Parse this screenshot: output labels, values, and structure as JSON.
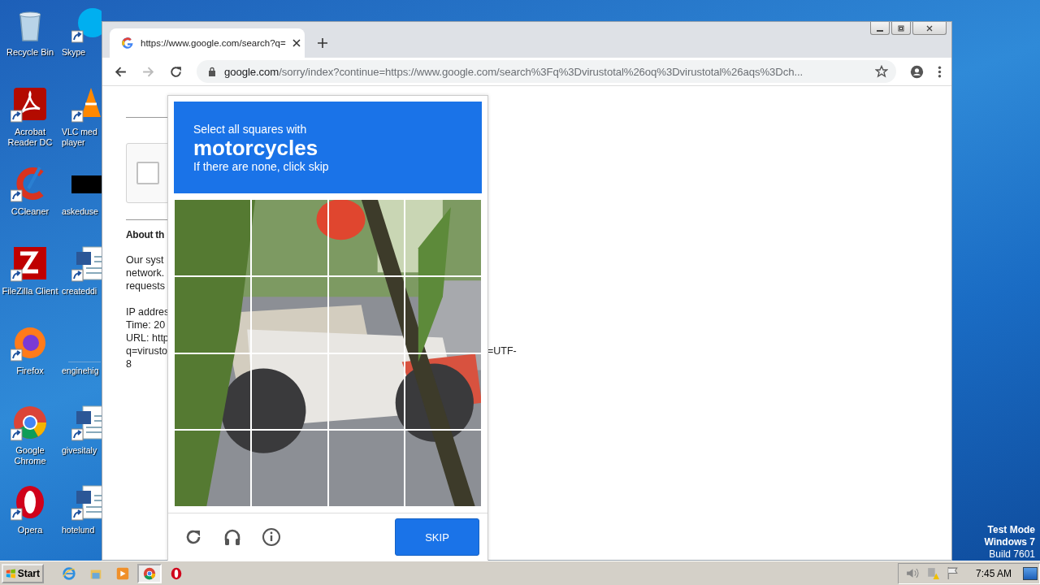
{
  "desktop": {
    "columns": [
      {
        "icons": [
          {
            "kind": "recycle",
            "shortcut": false,
            "label": [
              "Recycle Bin"
            ]
          },
          {
            "kind": "acrobat",
            "shortcut": true,
            "label": [
              "Acrobat",
              "Reader DC"
            ]
          },
          {
            "kind": "ccleaner",
            "shortcut": true,
            "label": [
              "CCleaner"
            ]
          },
          {
            "kind": "filezilla",
            "shortcut": true,
            "label": [
              "FileZilla Client"
            ]
          },
          {
            "kind": "firefox",
            "shortcut": true,
            "label": [
              "Firefox"
            ]
          },
          {
            "kind": "chrome",
            "shortcut": true,
            "label": [
              "Google",
              "Chrome"
            ]
          },
          {
            "kind": "opera",
            "shortcut": true,
            "label": [
              "Opera"
            ]
          }
        ]
      },
      {
        "icons": [
          {
            "kind": "skype",
            "shortcut": true,
            "label": [
              "Skype"
            ]
          },
          {
            "kind": "vlc",
            "shortcut": true,
            "label": [
              "VLC med",
              "player"
            ]
          },
          {
            "kind": "blackbox",
            "shortcut": false,
            "label": [
              "askeduse"
            ]
          },
          {
            "kind": "word",
            "shortcut": true,
            "label": [
              "createddi"
            ]
          },
          {
            "kind": "none",
            "label": [
              "enginehig"
            ]
          },
          {
            "kind": "word",
            "shortcut": true,
            "label": [
              "givesitaly"
            ]
          },
          {
            "kind": "word",
            "shortcut": true,
            "label": [
              "hotelund"
            ]
          }
        ]
      }
    ],
    "system_notice": [
      "Test Mode",
      "Windows 7",
      "Build 7601"
    ]
  },
  "browser": {
    "tabs": [
      {
        "title": "https://www.google.com/search?q=",
        "selected": true
      }
    ],
    "forward_disabled": true,
    "address": {
      "host": "google.com",
      "path": "/sorry/index?continue=https://www.google.com/search%3Fq%3Dvirustotal%26oq%3Dvirustotal%26aqs%3Dch..."
    },
    "page": {
      "about_title": "About th",
      "paragraphs": [
        [
          {
            "text": "Our syst"
          },
          {
            "text": "network."
          },
          {
            "text": "requests"
          }
        ],
        [
          {
            "text": "IP addres"
          },
          {
            "text": "Time: 20"
          },
          {
            "text": "URL: http"
          },
          {
            "text": "q=virusto",
            "tail": "=UTF-"
          },
          {
            "text": "8"
          }
        ]
      ],
      "checkbox": {
        "checked": false
      }
    },
    "captcha": {
      "prompt": "Select all squares with",
      "target": "motorcycles",
      "hint": "If there are none, click skip",
      "tiles": [
        {
          "selected": false
        },
        {
          "selected": false
        },
        {
          "selected": false
        },
        {
          "selected": false
        },
        {
          "selected": false
        },
        {
          "selected": false
        },
        {
          "selected": false
        },
        {
          "selected": false
        },
        {
          "selected": false
        },
        {
          "selected": false
        },
        {
          "selected": false
        },
        {
          "selected": false
        },
        {
          "selected": false
        },
        {
          "selected": false
        },
        {
          "selected": false
        },
        {
          "selected": false
        }
      ],
      "button": "SKIP"
    }
  },
  "taskbar": {
    "start": "Start",
    "apps": [
      {
        "kind": "ie",
        "active": false
      },
      {
        "kind": "explorer",
        "active": false
      },
      {
        "kind": "media",
        "active": false
      },
      {
        "kind": "chrome",
        "active": true
      },
      {
        "kind": "opera",
        "active": false
      }
    ],
    "clock": "7:45 AM"
  }
}
